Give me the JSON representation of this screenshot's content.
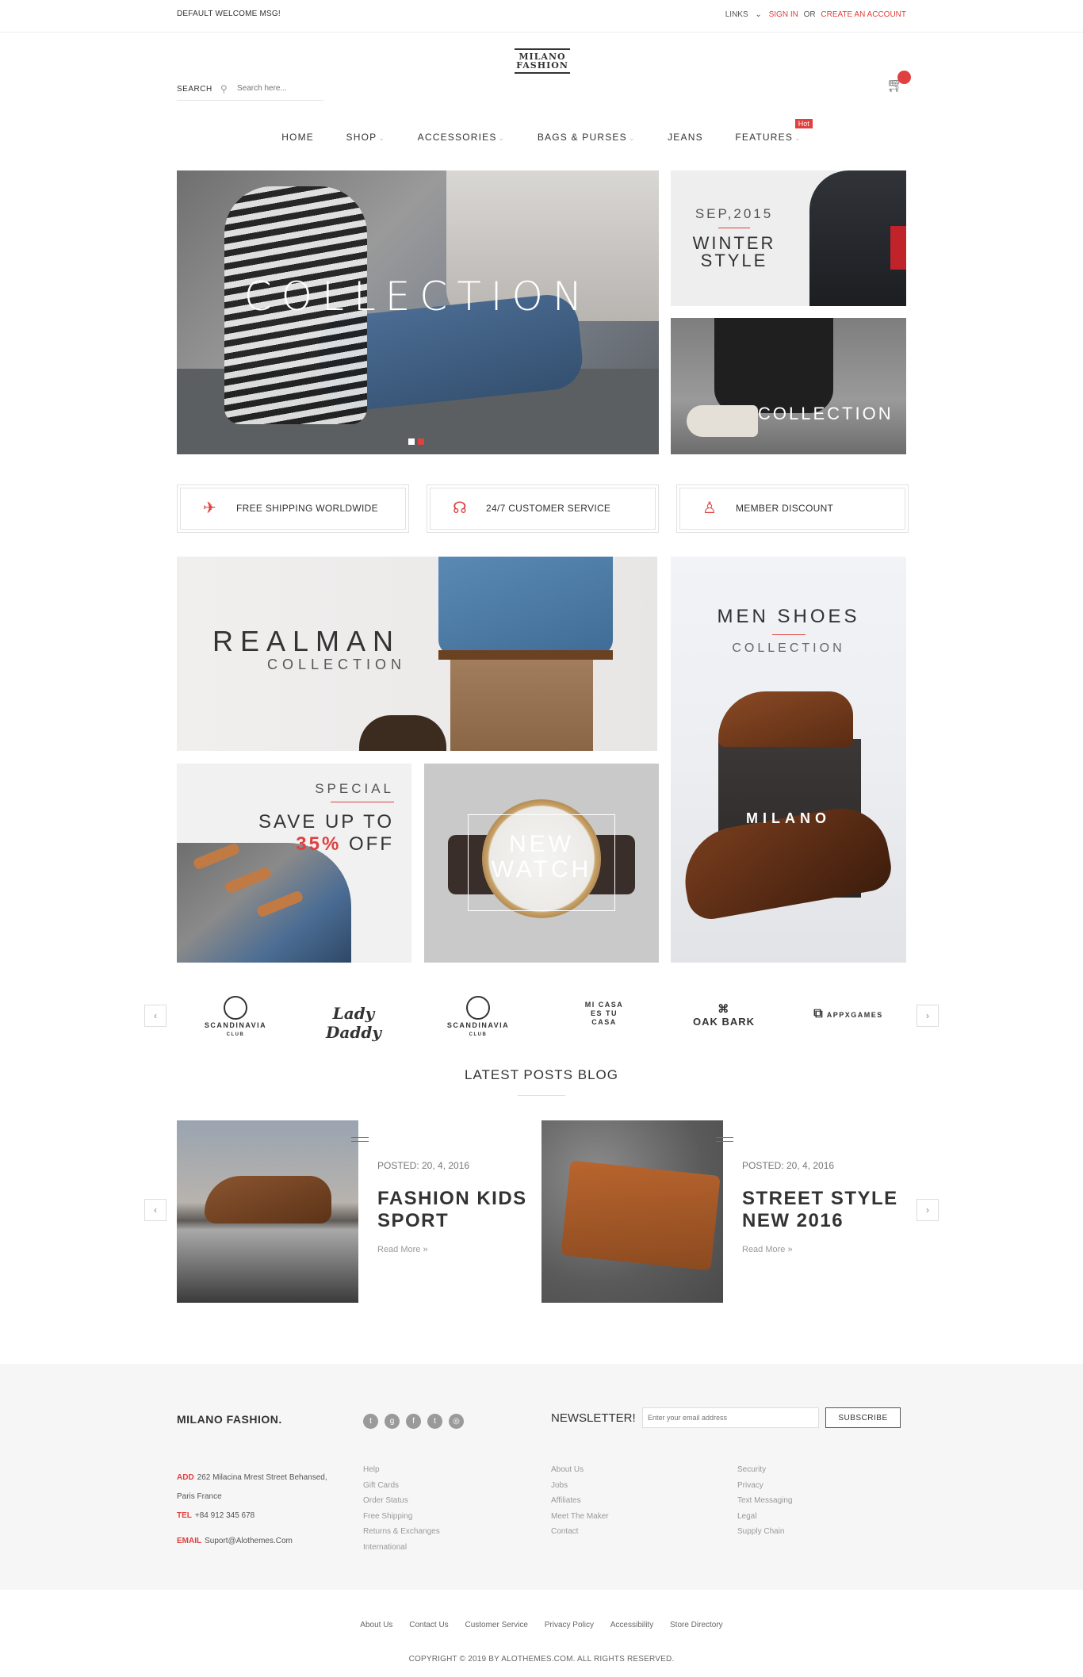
{
  "topbar": {
    "welcome": "DEFAULT WELCOME MSG!",
    "links": "LINKS",
    "sign_in": "SIGN IN",
    "or": "OR",
    "create_account": "CREATE AN ACCOUNT"
  },
  "logo": {
    "line1": "MILANO",
    "line2": "FASHION"
  },
  "search": {
    "label": "SEARCH",
    "placeholder": "Search here..."
  },
  "nav": {
    "items": [
      "HOME",
      "SHOP",
      "ACCESSORIES",
      "BAGS & PURSES",
      "JEANS",
      "FEATURES"
    ],
    "hot_badge": "Hot"
  },
  "banners": {
    "main_title": "COLLECTION",
    "winter_date": "SEP,2015",
    "winter_title_1": "WINTER",
    "winter_title_2": "STYLE",
    "street_title": "COLLECTION"
  },
  "features": [
    {
      "label": "FREE SHIPPING WORLDWIDE",
      "icon": "plane-icon"
    },
    {
      "label": "24/7 CUSTOMER SERVICE",
      "icon": "headset-icon"
    },
    {
      "label": "MEMBER DISCOUNT",
      "icon": "user-icon"
    }
  ],
  "promo": {
    "realman_1": "REALMAN",
    "realman_2": "COLLECTION",
    "shoes_1": "MEN SHOES",
    "shoes_2": "COLLECTION",
    "shoes_brand": "MILANO",
    "special": "SPECIAL",
    "save_1": "SAVE UP TO",
    "save_pct": "35%",
    "save_off": "OFF",
    "watch_1": "NEW",
    "watch_2": "WATCH"
  },
  "brands": {
    "items": [
      {
        "name": "SCANDINAVIA",
        "sub": "CLUB"
      },
      {
        "name": "Lady Daddy"
      },
      {
        "name": "SCANDINAVIA",
        "sub": "CLUB"
      },
      {
        "name": "MI CASA ES TU CASA"
      },
      {
        "name": "OAK BARK"
      },
      {
        "name": "APPXGAMES"
      }
    ]
  },
  "blog": {
    "title": "LATEST POSTS BLOG",
    "posts": [
      {
        "date": "POSTED: 20, 4, 2016",
        "title_1": "FASHION KIDS",
        "title_2": "SPORT",
        "more": "Read More »"
      },
      {
        "date": "POSTED: 20, 4, 2016",
        "title_1": "STREET STYLE",
        "title_2": "NEW 2016",
        "more": "Read More »"
      }
    ]
  },
  "footer": {
    "brand": "MILANO FASHION.",
    "newsletter_label": "NEWSLETTER!",
    "newsletter_placeholder": "Enter your email address",
    "subscribe": "SUBSCRIBE",
    "add_key": "ADD",
    "add_1": "262 Milacina Mrest Street Behansed,",
    "add_2": "Paris France",
    "tel_key": "TEL",
    "tel": "+84 912 345 678",
    "email_key": "EMAIL",
    "email": "Suport@Alothemes.Com",
    "col1": [
      "Help",
      "Gift Cards",
      "Order Status",
      "Free Shipping",
      "Returns & Exchanges",
      "International"
    ],
    "col2": [
      "About Us",
      "Jobs",
      "Affiliates",
      "Meet The Maker",
      "Contact"
    ],
    "col3": [
      "Security",
      "Privacy",
      "Text Messaging",
      "Legal",
      "Supply Chain"
    ],
    "bottom_links": [
      "About Us",
      "Contact Us",
      "Customer Service",
      "Privacy Policy",
      "Accessibility",
      "Store Directory"
    ],
    "copyright": "COPYRIGHT © 2019 BY ALOTHEMES.COM. ALL RIGHTS RESERVED."
  },
  "colors": {
    "accent": "#e0403f"
  }
}
